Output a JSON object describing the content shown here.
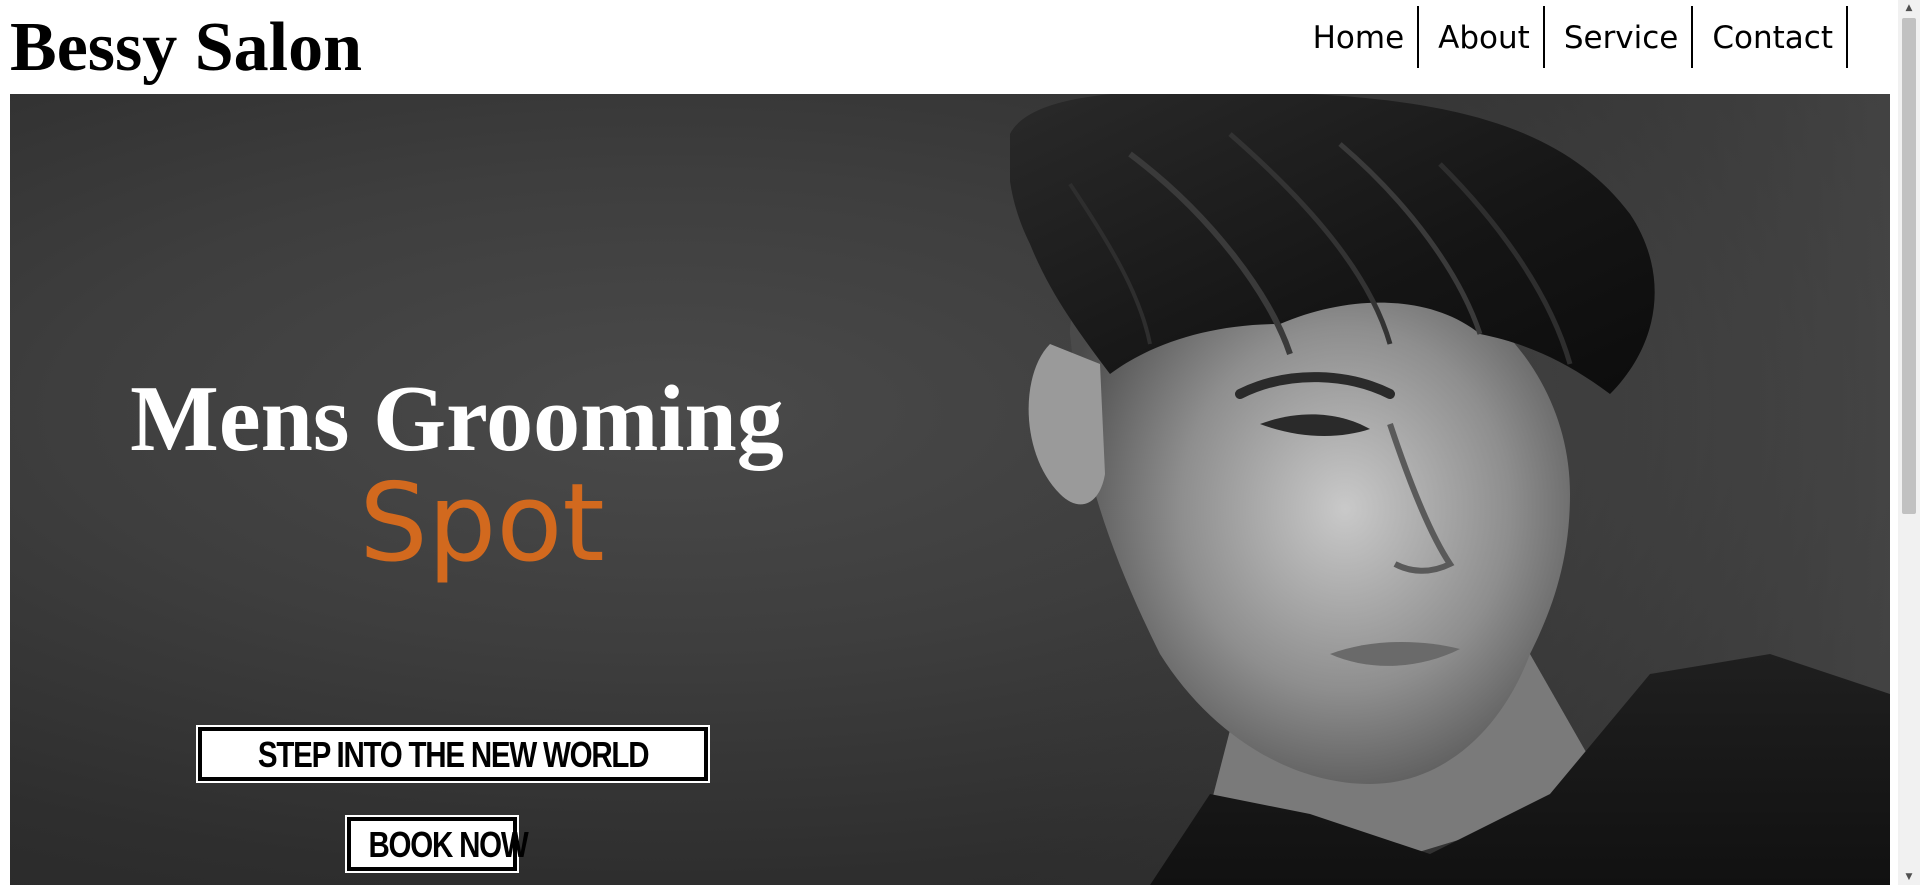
{
  "header": {
    "brand": "Bessy Salon",
    "nav": [
      {
        "label": "Home"
      },
      {
        "label": "About"
      },
      {
        "label": "Service"
      },
      {
        "label": "Contact"
      }
    ]
  },
  "hero": {
    "title_line1": "Mens Grooming",
    "title_line2": "Spot",
    "accent_color": "#d2691e",
    "cta_primary": "STEP INTO THE NEW WORLD",
    "cta_secondary": "BOOK NOW",
    "image": "black-and-white-portrait-man-styled-hair"
  },
  "scrollbar": {
    "up_icon": "triangle-up-icon",
    "down_icon": "triangle-down-icon"
  }
}
